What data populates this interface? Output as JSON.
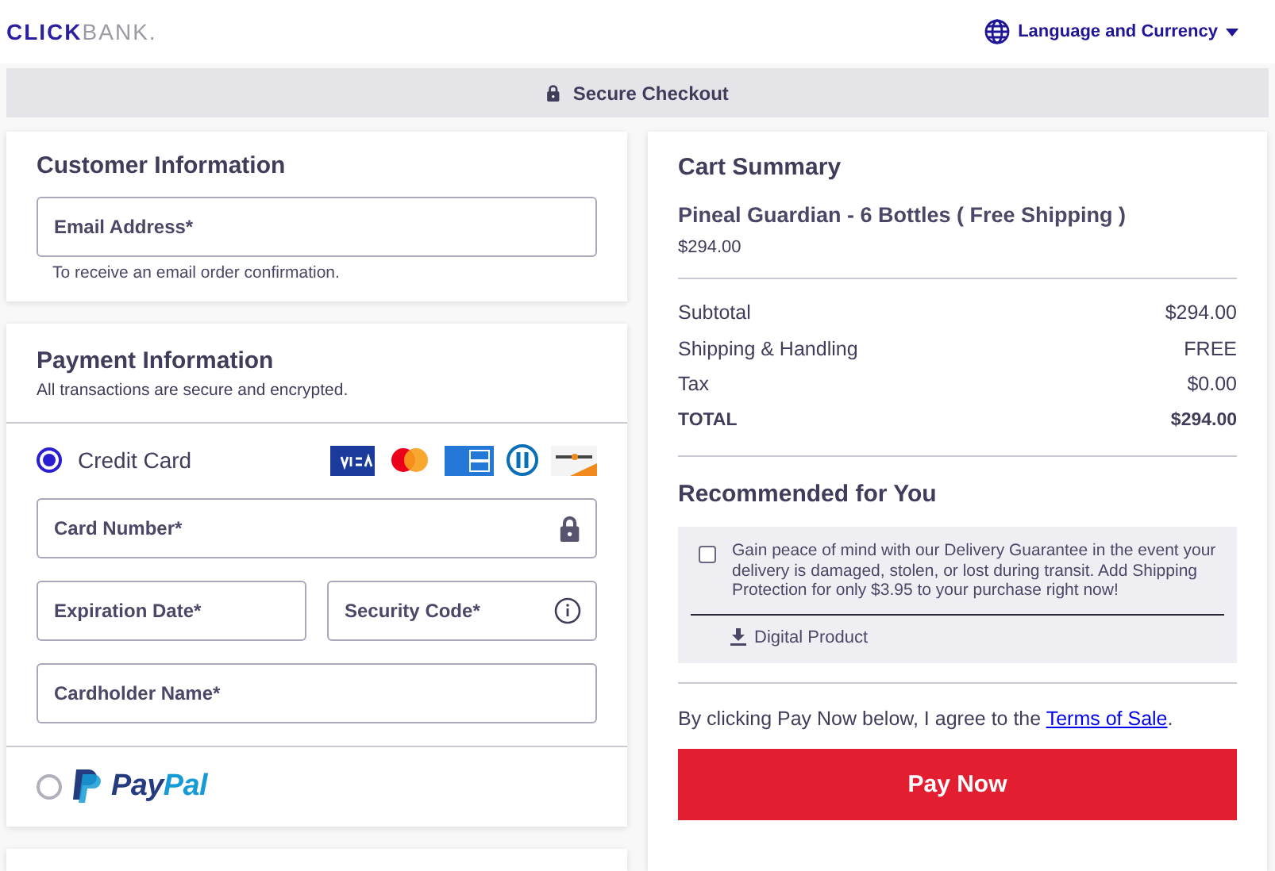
{
  "header": {
    "logo": [
      "CLICK",
      "BANK."
    ],
    "language_menu": "Language and Currency"
  },
  "secure_bar": {
    "label": "Secure Checkout"
  },
  "customer": {
    "title": "Customer Information",
    "email": {
      "placeholder": "Email Address*"
    },
    "helper": "To receive an email order confirmation."
  },
  "payment": {
    "title": "Payment Information",
    "subtitle": "All transactions are secure and encrypted.",
    "methods": [
      {
        "kind": "card",
        "label": "Credit Card",
        "selected": true
      },
      {
        "kind": "paypal",
        "label": [
          "Pay",
          "Pal"
        ],
        "selected": false
      }
    ],
    "fields": [
      [
        {
          "placeholder": "Card Number*",
          "kind": "secure"
        }
      ],
      [
        {
          "placeholder": "Expiration Date*",
          "kind": "plain"
        },
        {
          "placeholder": "Security Code*",
          "kind": "help"
        }
      ],
      [
        {
          "placeholder": "Cardholder Name*",
          "kind": "plain"
        }
      ]
    ]
  },
  "cart": {
    "title": "Cart Summary",
    "product": "Pineal Guardian - 6 Bottles ( Free Shipping )",
    "product_price": "$294.00",
    "rows": [
      {
        "label": "Subtotal",
        "value": "$294.00",
        "kind": "normal"
      },
      {
        "label": "Shipping & Handling",
        "value": "FREE",
        "kind": "normal"
      },
      {
        "label": "Tax",
        "value": "$0.00",
        "kind": "normal"
      },
      {
        "label": "TOTAL",
        "value": "$294.00",
        "kind": "total"
      }
    ],
    "recommended_title": "Recommended for You",
    "offer": {
      "checked": false,
      "text": "Gain peace of mind with our Delivery Guarantee in the event your delivery is damaged, stolen, or lost during transit. Add Shipping Protection for only $3.95 to your purchase right now!",
      "product_type": "Digital Product"
    },
    "terms": {
      "before": "By clicking Pay Now below, I agree to the ",
      "link": "Terms of Sale",
      "after": "."
    },
    "pay_button": "Pay Now"
  }
}
